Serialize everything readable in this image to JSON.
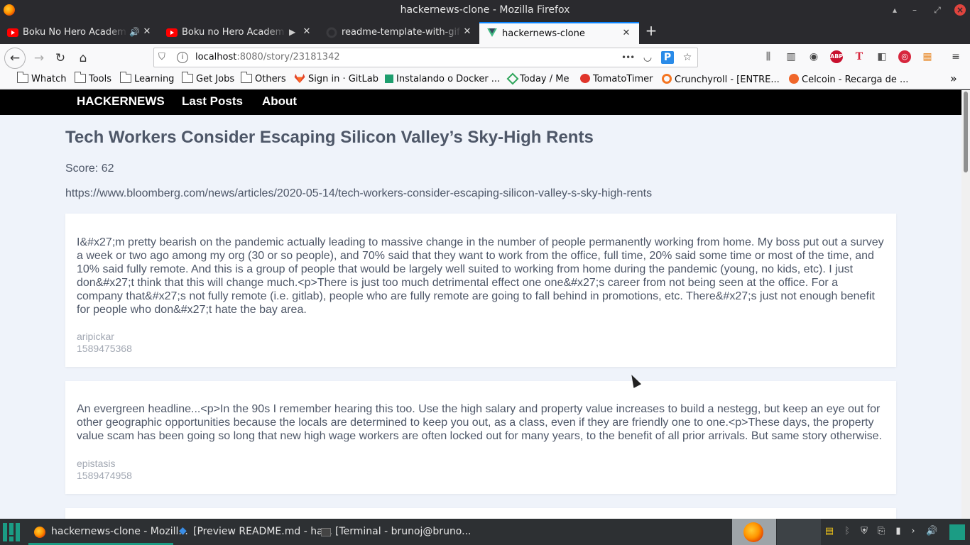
{
  "window": {
    "title": "hackernews-clone - Mozilla Firefox"
  },
  "tabs": [
    {
      "label": "Boku No Hero Academia",
      "favicon": "youtube-icon",
      "media": "🔊"
    },
    {
      "label": "Boku no Hero Academia",
      "favicon": "youtube-icon",
      "media": "▶"
    },
    {
      "label": "readme-template-with-gif",
      "favicon": "github-icon",
      "media": ""
    },
    {
      "label": "hackernews-clone",
      "favicon": "vue-icon",
      "media": ""
    }
  ],
  "toolbar": {
    "url_host": "localhost",
    "url_rest": ":8080/story/23181342",
    "more_label": "•••"
  },
  "bookmarks": [
    {
      "label": "Whatch",
      "icon": "folder-icon"
    },
    {
      "label": "Tools",
      "icon": "folder-icon"
    },
    {
      "label": "Learning",
      "icon": "folder-icon"
    },
    {
      "label": "Get Jobs",
      "icon": "folder-icon"
    },
    {
      "label": "Others",
      "icon": "folder-icon"
    },
    {
      "label": "Sign in · GitLab",
      "icon": "gitlab-icon"
    },
    {
      "label": "Instalando o Docker ...",
      "icon": "docker-icon"
    },
    {
      "label": "Today / Me",
      "icon": "today-icon"
    },
    {
      "label": "TomatoTimer",
      "icon": "tomato-icon"
    },
    {
      "label": "Crunchyroll - [ENTRE...",
      "icon": "crunchyroll-icon"
    },
    {
      "label": "Celcoin - Recarga de ...",
      "icon": "celcoin-icon"
    }
  ],
  "app": {
    "nav": {
      "brand": "HACKERNEWS",
      "last_posts": "Last Posts",
      "about": "About"
    },
    "story": {
      "title": "Tech Workers Consider Escaping Silicon Valley’s Sky-High Rents",
      "score": "Score: 62",
      "url": "https://www.bloomberg.com/news/articles/2020-05-14/tech-workers-consider-escaping-silicon-valley-s-sky-high-rents"
    },
    "comments": [
      {
        "text": "I&#x27;m pretty bearish on the pandemic actually leading to massive change in the number of people permanently working from home. My boss put out a survey a week or two ago among my org (30 or so people), and 70% said that they want to work from the office, full time, 20% said some time or most of the time, and 10% said fully remote. And this is a group of people that would be largely well suited to working from home during the pandemic (young, no kids, etc). I just don&#x27;t think that this will change much.<p>There is just too much detrimental effect one one&#x27;s career from not being seen at the office. For a company that&#x27;s not fully remote (i.e. gitlab), people who are fully remote are going to fall behind in promotions, etc. There&#x27;s just not enough benefit for people who don&#x27;t hate the bay area.",
        "author": "aripickar",
        "time": "1589475368"
      },
      {
        "text": "An evergreen headline...<p>In the 90s I remember hearing this too. Use the high salary and property value increases to build a nestegg, but keep an eye out for other geographic opportunities because the locals are determined to keep you out, as a class, even if they are friendly one to one.<p>These days, the property value scam has been going so long that new high wage workers are often locked out for many years, to the benefit of all prior arrivals. But same story otherwise.",
        "author": "epistasis",
        "time": "1589474958"
      }
    ]
  },
  "taskbar": {
    "items": [
      {
        "label": "hackernews-clone - Mozill...",
        "icon": "firefox-icon"
      },
      {
        "label": "[Preview README.md - ha...",
        "icon": "vscode-icon"
      },
      {
        "label": "[Terminal - brunoj@bruno...",
        "icon": "terminal-icon"
      }
    ]
  }
}
